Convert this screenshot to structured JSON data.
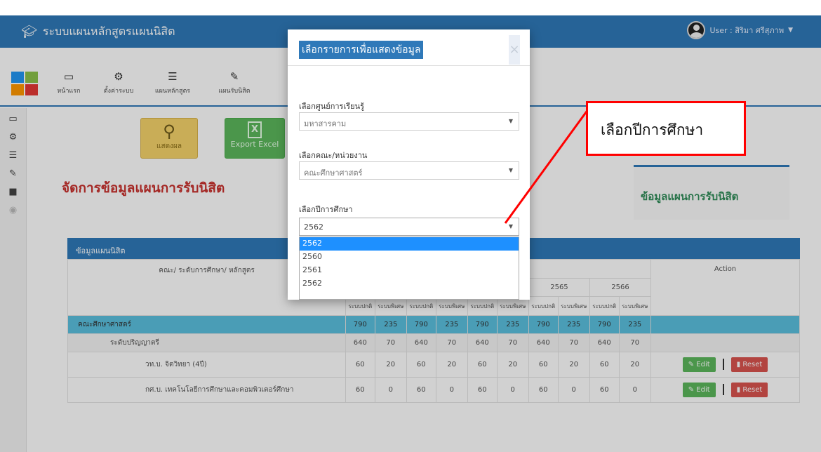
{
  "navbar": {
    "brand": "ระบบแผนหลักสูตรแผนนิสิต",
    "user": "User : สิริมา ศรีสุภาพ"
  },
  "toolbar": {
    "items": [
      {
        "label": "หน้าแรก",
        "icon": "monitor-icon"
      },
      {
        "label": "ตั้งค่าระบบ",
        "icon": "cogs-icon"
      },
      {
        "label": "แผนหลักสูตร",
        "icon": "list-icon"
      },
      {
        "label": "แผนรับนิสิต",
        "icon": "edit-icon"
      }
    ],
    "logo_colors": [
      "#2196f3",
      "#8bc34a",
      "#ff9800",
      "#e53935"
    ]
  },
  "actions": {
    "show_label": "แสดงผล",
    "excel_label": "Export Excel"
  },
  "page": {
    "title": "จัดการข้อมูลแผนการรับนิสิต",
    "right_panel_title": "ข้อมูลแผนการรับนิสิต"
  },
  "table": {
    "header": "ข้อมูลแผนนิสิต",
    "col_faculty": "คณะ/ ระดับการศึกษา/ หลักสูตร",
    "col_action": "Action",
    "years": [
      "2565",
      "2566"
    ],
    "sub_normal": "ระบบปกติ",
    "sub_special": "ระบบพิเศษ",
    "rows": [
      {
        "kind": "faculty",
        "name": "คณะศึกษาศาสตร์",
        "values": [
          "790",
          "235",
          "790",
          "235",
          "790",
          "235",
          "790",
          "235",
          "790",
          "235"
        ]
      },
      {
        "kind": "level",
        "name": "ระดับปริญญาตรี",
        "values": [
          "640",
          "70",
          "640",
          "70",
          "640",
          "70",
          "640",
          "70",
          "640",
          "70"
        ]
      },
      {
        "kind": "program",
        "name": "วท.บ. จิตวิทยา (4ปี)",
        "values": [
          "60",
          "20",
          "60",
          "20",
          "60",
          "20",
          "60",
          "20",
          "60",
          "20"
        ]
      },
      {
        "kind": "program",
        "name": "กศ.บ. เทคโนโลยีการศึกษาและคอมพิวเตอร์ศึกษา",
        "values": [
          "60",
          "0",
          "60",
          "0",
          "60",
          "0",
          "60",
          "0",
          "60",
          "0"
        ]
      }
    ],
    "edit_label": "Edit",
    "reset_label": "Reset"
  },
  "modal": {
    "title": "เลือกรายการเพื่อแสดงข้อมูล",
    "close": "×",
    "center_label": "เลือกศูนย์การเรียนรู้",
    "center_value": "มหาสารคาม",
    "faculty_label": "เลือกคณะ/หน่วยงาน",
    "faculty_value": "คณะศึกษาศาสตร์",
    "year_label": "เลือกปีการศึกษา",
    "year_value": "2562",
    "year_options": [
      "2562",
      "2560",
      "2561",
      "2562"
    ]
  },
  "callout": {
    "text": "เลือกปีการศึกษา",
    "color": "#ff0000"
  }
}
